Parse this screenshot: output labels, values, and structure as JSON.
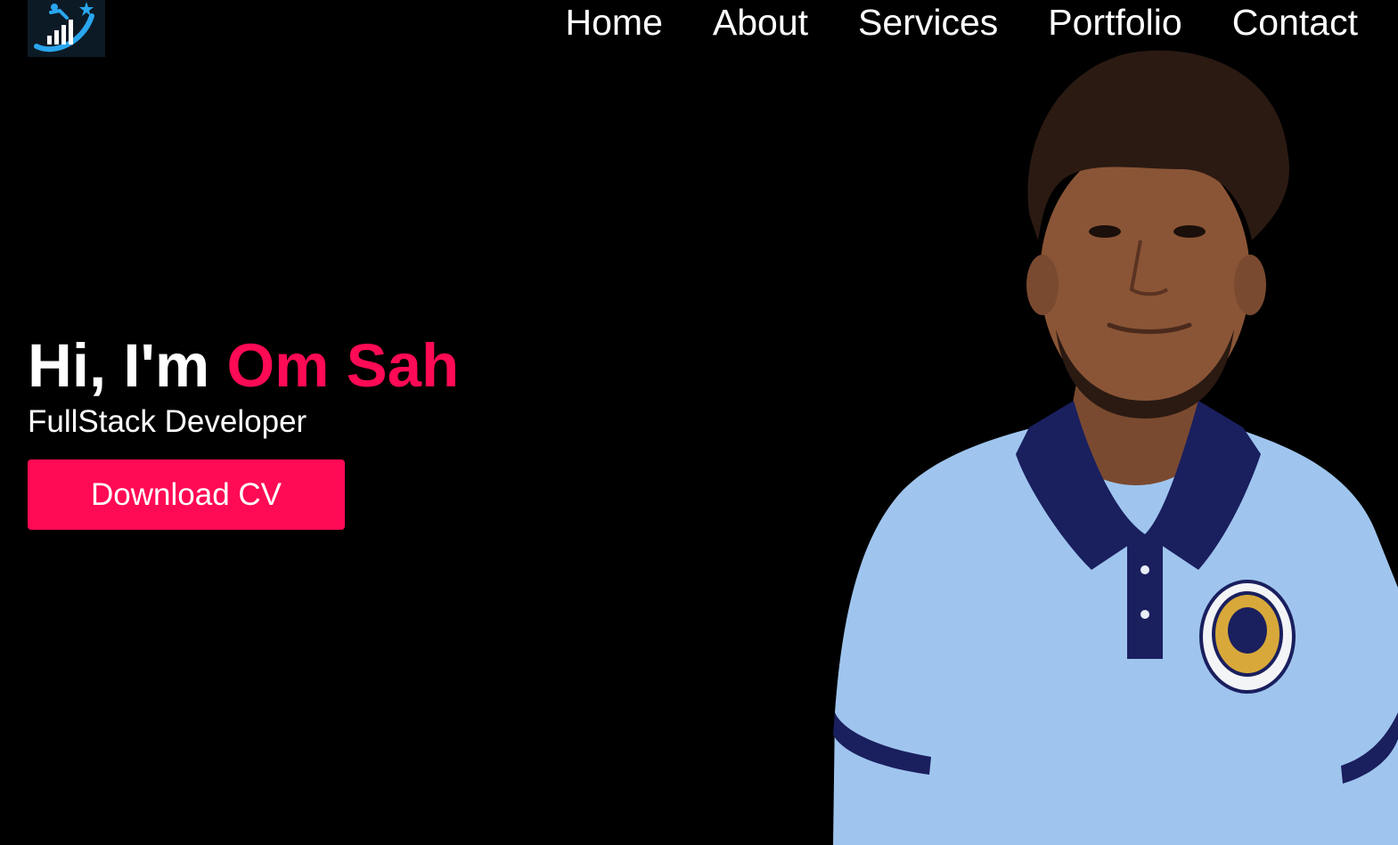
{
  "header": {
    "logo_icon": "logo-icon",
    "nav": [
      {
        "label": "Home"
      },
      {
        "label": "About"
      },
      {
        "label": "Services"
      },
      {
        "label": "Portfolio"
      },
      {
        "label": "Contact"
      }
    ]
  },
  "hero": {
    "greeting": "Hi, I'm",
    "name": "Om Sah",
    "subtitle": "FullStack Developer",
    "cta_label": "Download CV",
    "photo": "profile-photo"
  },
  "colors": {
    "background": "#000000",
    "accent": "#ff0a54",
    "text": "#ffffff",
    "shirt": "#9fc5ee"
  }
}
